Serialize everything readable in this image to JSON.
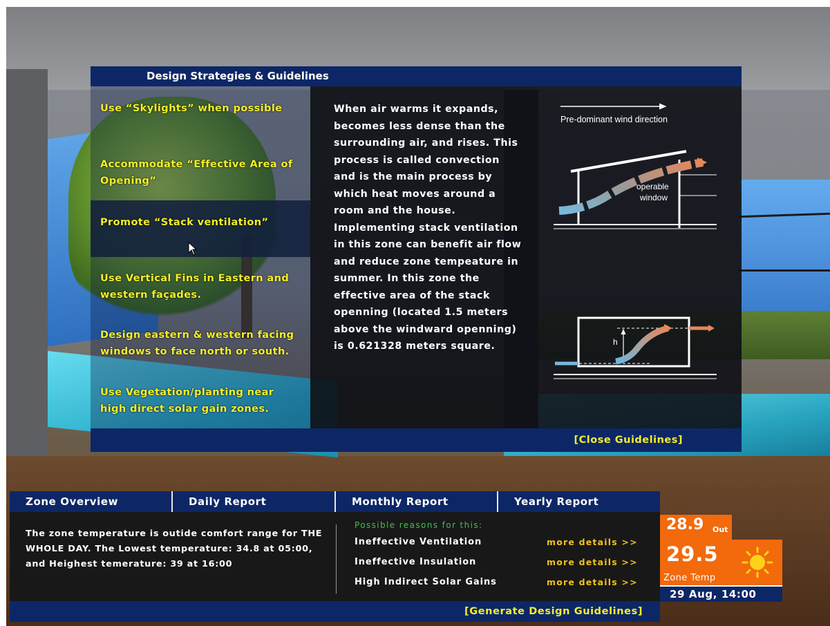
{
  "guidelines_panel": {
    "title": "Design Strategies & Guidelines",
    "items": [
      {
        "label": "Use “Skylights” when possible"
      },
      {
        "label": "Accommodate “Effective Area of Opening”"
      },
      {
        "label": "Promote “Stack ventilation”",
        "selected": true
      },
      {
        "label": "Use Vertical Fins in Eastern and western façades."
      },
      {
        "label": "Design eastern & western facing windows to face north or south."
      },
      {
        "label": "Use Vegetation/planting near high direct solar gain zones."
      }
    ],
    "description": "When air warms it expands,\nbecomes less dense than the\nsurrounding air, and rises. This\nprocess is called convection\nand is the main process by\nwhich heat moves around a\nroom and the house.\nImplementing stack ventilation\nin this zone can benefit air flow\nand reduce zone tempeature in\nsummer. In this zone the\neffective area of the stack\nopenning (located 1.5 meters\nabove the windward openning)\nis 0.621328 meters square.",
    "diagram": {
      "wind_label": "Pre-dominant wind direction",
      "window_label_line1": "operable",
      "window_label_line2": "window",
      "height_label": "h"
    },
    "close_label": "[Close Guidelines]"
  },
  "report": {
    "tabs": [
      {
        "label": "Zone Overview"
      },
      {
        "label": "Daily Report"
      },
      {
        "label": "Monthly Report"
      },
      {
        "label": "Yearly Report"
      }
    ],
    "summary": "The zone temperature is outide comfort range for THE WHOLE DAY. The Lowest temperature: 34.8 at 05:00, and Heighest temerature: 39 at 16:00",
    "reasons_title": "Possible reasons for this:",
    "reasons": [
      {
        "label": "Ineffective Ventilation",
        "link": "more details >>"
      },
      {
        "label": "Ineffective Insulation",
        "link": "more details >>"
      },
      {
        "label": "High Indirect Solar Gains",
        "link": "more details >>"
      }
    ],
    "generate_label": "[Generate Design Guidelines]"
  },
  "weather": {
    "outdoor_temp": "28.9",
    "outdoor_label": "Out",
    "zone_temp": "29.5",
    "zone_label": "Zone Temp",
    "datetime": "29 Aug, 14:00",
    "icon": "sun-icon",
    "accent_color": "#f26a0c"
  },
  "colors": {
    "panel_blue": "#0d2766",
    "highlight_yellow": "#f4ee2a",
    "link_orange": "#f2c21a",
    "reasons_green": "#3ec24a"
  }
}
